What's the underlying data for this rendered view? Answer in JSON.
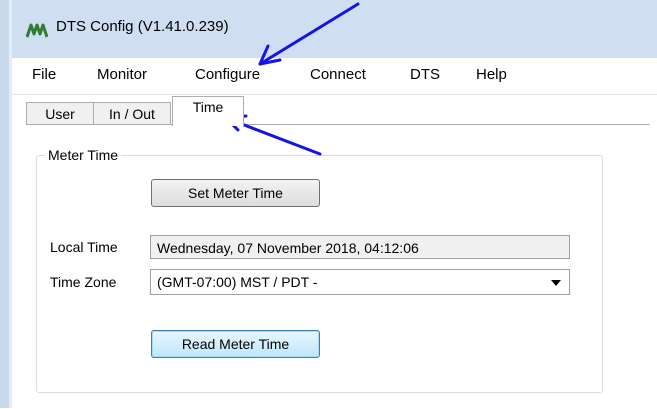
{
  "window": {
    "title": "DTS Config (V1.41.0.239)",
    "icon": "dts-logo-icon",
    "accent_color": "#2e7d32"
  },
  "menu": {
    "items": [
      "File",
      "Monitor",
      "Configure",
      "Connect",
      "DTS",
      "Help"
    ]
  },
  "tabs": {
    "items": [
      "User",
      "In / Out",
      "Time"
    ],
    "active": "Time"
  },
  "meter_time": {
    "group_label": "Meter Time",
    "set_button": "Set Meter Time",
    "local_time_label": "Local Time",
    "local_time_value": "Wednesday, 07 November 2018, 04:12:06",
    "time_zone_label": "Time Zone",
    "time_zone_value": "(GMT-07:00) MST / PDT -",
    "read_button": "Read Meter Time"
  },
  "annotations": {
    "arrow_color": "#1414e6"
  }
}
